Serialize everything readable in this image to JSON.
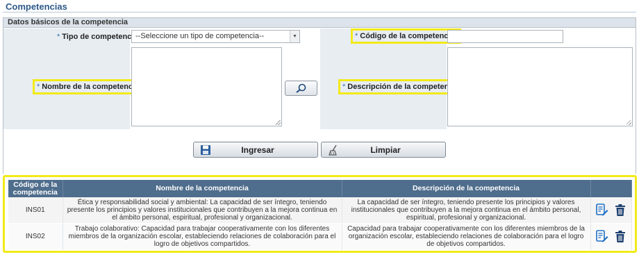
{
  "page": {
    "title": "Competencias"
  },
  "section": {
    "title": "Datos básicos de la competencia"
  },
  "form": {
    "tipo_label": "Tipo de competencia:",
    "tipo_value": "--Seleccione un tipo de competencia--",
    "nombre_label": "Nombre de la competencia:",
    "codigo_label": "Código de la competencia:",
    "descripcion_label": "Descripción de la competencia:",
    "required_mark": "*"
  },
  "buttons": {
    "ingresar": "Ingresar",
    "limpiar": "Limpiar"
  },
  "table": {
    "headers": [
      "Código de la competencia",
      "Nombre de la competencia",
      "Descripción de la competencia",
      ""
    ],
    "rows": [
      {
        "codigo": "INS01",
        "nombre": "Ética y responsabilidad social y ambiental: La capacidad de ser íntegro, teniendo presente los principios y valores institucionales que contribuyen a la mejora continua en el ámbito personal, espiritual, profesional y organizacional.",
        "descripcion": "La capacidad de ser íntegro, teniendo presente los principios y valores institucionales que contribuyen a la mejora continua en el ámbito personal, espiritual, profesional y organizacional."
      },
      {
        "codigo": "INS02",
        "nombre": "Trabajo colaborativo: Capacidad para trabajar cooperativamente con los diferentes miembros de la organización escolar, estableciendo relaciones de colaboración para el logro de objetivos compartidos.",
        "descripcion": "Capacidad para trabajar cooperativamente con los diferentes miembros de la organización escolar, estableciendo relaciones de colaboración para el logro de objetivos compartidos."
      }
    ]
  },
  "icons": {
    "lookup": "magnifier-icon",
    "save": "floppy-disk-icon",
    "clear": "broom-icon",
    "edit": "edit-document-icon",
    "delete": "trash-icon"
  },
  "colors": {
    "accent": "#2e5a8a",
    "header_bg": "#4f6d8c",
    "highlight": "#f2ea18",
    "icon_blue": "#1f6fc4",
    "trash": "#1c3f6e"
  }
}
